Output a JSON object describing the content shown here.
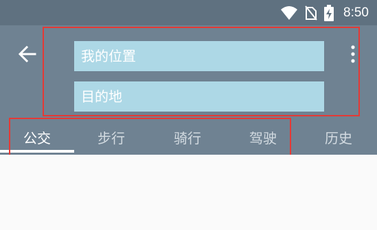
{
  "status_bar": {
    "time": "8:50"
  },
  "search": {
    "origin_placeholder": "我的位置",
    "destination_placeholder": "目的地"
  },
  "tabs": [
    {
      "label": "公交",
      "active": true
    },
    {
      "label": "步行",
      "active": false
    },
    {
      "label": "骑行",
      "active": false
    },
    {
      "label": "驾驶",
      "active": false
    },
    {
      "label": "历史",
      "active": false
    }
  ],
  "icons": {
    "status": [
      "wifi-icon",
      "no-sim-icon",
      "battery-charging-icon"
    ],
    "app_bar": [
      "back-arrow-icon",
      "more-vert-icon"
    ]
  },
  "colors": {
    "status_bar": "#5f7180",
    "app_bar": "#6f8292",
    "input_background": "#add8e6",
    "tab_indicator": "#ffffff",
    "annotation_box": "#e53935"
  }
}
